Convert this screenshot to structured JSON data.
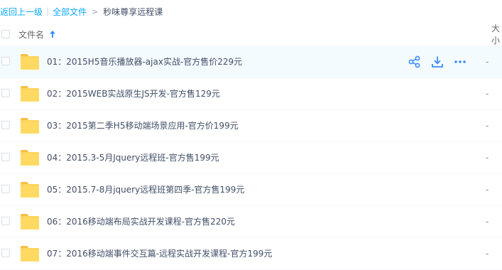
{
  "breadcrumb": {
    "back": "返回上一级",
    "separator": "|",
    "all_files": "全部文件",
    "arrow": ">",
    "current": "秒味尊享远程课"
  },
  "header": {
    "name_label": "文件名",
    "sort_icon": "arrow-up-icon",
    "size_label": "大小"
  },
  "files": [
    {
      "name": "01：2015H5音乐播放器-ajax实战-官方售价229元",
      "size": "-"
    },
    {
      "name": "02：2015WEB实战原生JS开发-官方售129元",
      "size": "-"
    },
    {
      "name": "03：2015第二季H5移动端场景应用-官方价199元",
      "size": "-"
    },
    {
      "name": "04：2015.3-5月Jquery远程班-官方售199元",
      "size": "-"
    },
    {
      "name": "05：2015.7-8月jquery远程班第四季-官方售199元",
      "size": "-"
    },
    {
      "name": "06：2016移动端布局实战开发课程-官方售220元",
      "size": "-"
    },
    {
      "name": "07：2016移动端事件交互篇-远程实战开发课程-官方199元",
      "size": "-"
    }
  ],
  "row_actions": [
    "share-icon",
    "download-icon",
    "more-icon"
  ],
  "colors": {
    "accent": "#09aaff",
    "icon_blue": "#3b8cff",
    "hover_bg": "#f4fbff",
    "folder": "#ffda63"
  }
}
